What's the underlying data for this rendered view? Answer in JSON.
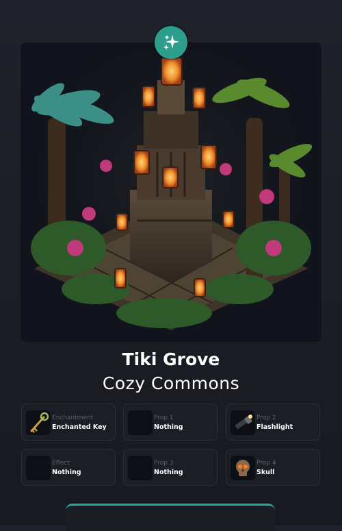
{
  "item": {
    "name": "Tiki Grove",
    "collection": "Cozy Commons",
    "rarity_icon": "sparkle-icon",
    "accent_color": "#2e9e8c"
  },
  "slots": [
    {
      "category": "Enchantment",
      "value": "Enchanted Key",
      "icon": "enchanted-key-icon"
    },
    {
      "category": "Prop 1",
      "value": "Nothing",
      "icon": "empty-slot-icon"
    },
    {
      "category": "Prop 2",
      "value": "Flashlight",
      "icon": "flashlight-icon"
    },
    {
      "category": "Effect",
      "value": "Nothing",
      "icon": "empty-slot-icon"
    },
    {
      "category": "Prop 3",
      "value": "Nothing",
      "icon": "empty-slot-icon"
    },
    {
      "category": "Prop 4",
      "value": "Skull",
      "icon": "skull-icon"
    }
  ]
}
